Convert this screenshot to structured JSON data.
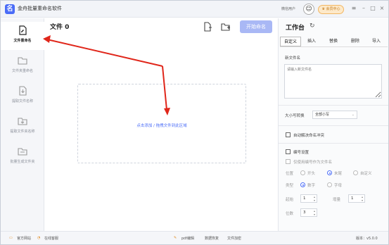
{
  "title_bar": {
    "app_title": "金舟批量重命名软件",
    "user_label": "微信用户",
    "member_button": "会员中心"
  },
  "sidebar": {
    "items": [
      {
        "label": "文件重命名",
        "icon": "file-rename-icon",
        "active": true
      },
      {
        "label": "文件夹重命名",
        "icon": "folder-rename-icon",
        "active": false
      },
      {
        "label": "提取文件名称",
        "icon": "extract-name-icon",
        "active": false
      },
      {
        "label": "提取文件夹名称",
        "icon": "extract-folder-name-icon",
        "active": false
      },
      {
        "label": "批量生成文件夹",
        "icon": "batch-create-folder-icon",
        "active": false
      }
    ]
  },
  "main": {
    "title": "文件 0",
    "start_button": "开始命名",
    "drop_text": "点击添加 / 拖拽文件到此区域"
  },
  "panel": {
    "title": "工作台",
    "tabs": [
      "自定义",
      "插入",
      "替换",
      "删除",
      "导入"
    ],
    "new_name_label": "新文件名",
    "new_name_placeholder": "请输入新文件名",
    "case_label": "大小写转换",
    "case_value": "全部小写",
    "auto_conflict_label": "自动解决命名冲突",
    "numbering_label": "编号设置",
    "numbering_only_label": "仅使用编号作为文件名",
    "position_label": "位置",
    "position_options": [
      "开头",
      "末尾",
      "自定义"
    ],
    "type_label": "类型",
    "type_options": [
      "数字",
      "字母"
    ],
    "start_label": "起始",
    "start_value": "1",
    "step_label": "增量",
    "step_value": "1",
    "digits_label": "位数",
    "digits_value": "3"
  },
  "statusbar": {
    "website": "官方网站",
    "support": "在线客服",
    "pdf": "pdf编辑",
    "recover": "数据恢复",
    "encrypt": "文件加密",
    "version": "版本：v5.0.0"
  },
  "colors": {
    "accent": "#4a6cf7",
    "start_button": "#a9b8f5",
    "member": "#f2b661"
  }
}
